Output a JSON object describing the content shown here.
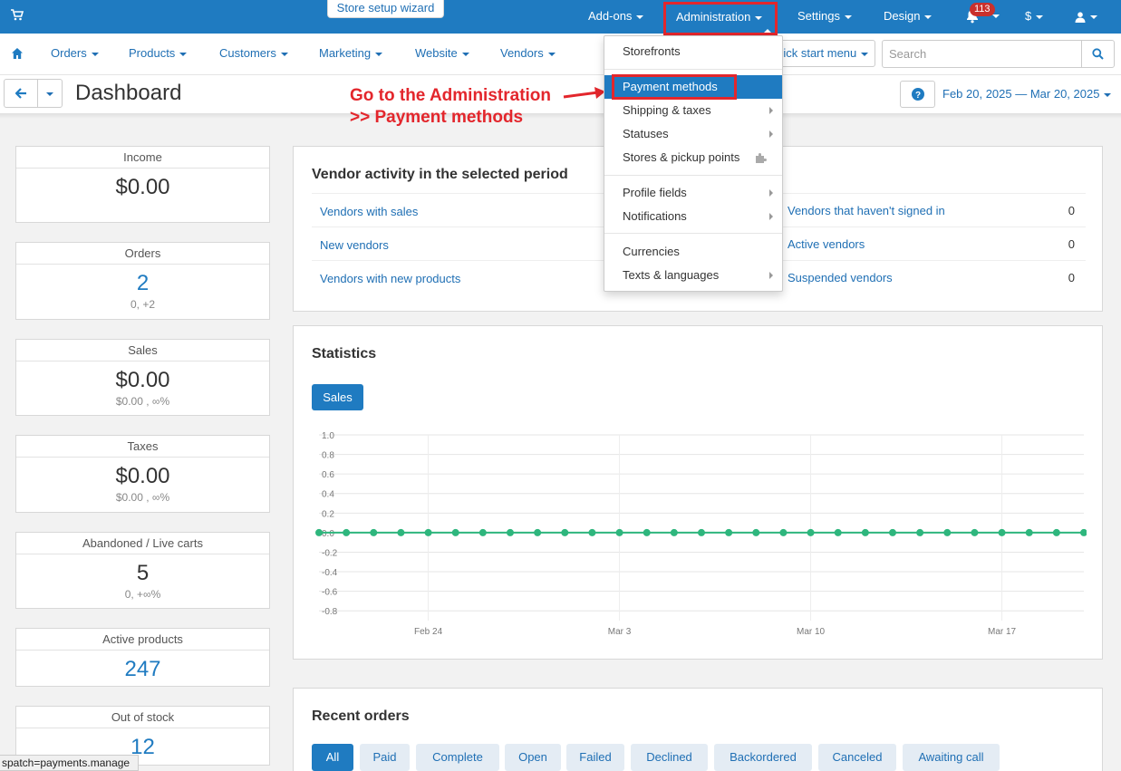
{
  "topbar": {
    "wizard_label": "Store setup wizard",
    "addons": "Add-ons",
    "administration": "Administration",
    "settings": "Settings",
    "design": "Design",
    "notification_count": "113",
    "currency": "$"
  },
  "nav": {
    "orders": "Orders",
    "products": "Products",
    "customers": "Customers",
    "marketing": "Marketing",
    "website": "Website",
    "vendors": "Vendors",
    "quick_start": "Quick start menu",
    "search_placeholder": "Search"
  },
  "header": {
    "title": "Dashboard",
    "date_range": "Feb 20, 2025 — Mar 20, 2025"
  },
  "annotation": {
    "line1": "Go to the Administration",
    "line2": ">> Payment methods"
  },
  "cards": [
    {
      "label": "Income",
      "value": "$0.00",
      "sub": ""
    },
    {
      "label": "Orders",
      "value": "2",
      "sub": "0, +2"
    },
    {
      "label": "Sales",
      "value": "$0.00",
      "sub": "$0.00 , ∞%"
    },
    {
      "label": "Taxes",
      "value": "$0.00",
      "sub": "$0.00 , ∞%"
    },
    {
      "label": "Abandoned / Live carts",
      "value": "5",
      "sub": "0, +∞%"
    },
    {
      "label": "Active products",
      "value": "247",
      "sub": ""
    },
    {
      "label": "Out of stock",
      "value": "12",
      "sub": ""
    }
  ],
  "vendor_activity": {
    "title": "Vendor activity in the selected period",
    "left": [
      "Vendors with sales",
      "New vendors",
      "Vendors with new products"
    ],
    "right": [
      {
        "label": "Vendors that haven't signed in",
        "value": "0"
      },
      {
        "label": "Active vendors",
        "value": "0"
      },
      {
        "label": "Suspended vendors",
        "value": "0"
      }
    ]
  },
  "statistics": {
    "title": "Statistics",
    "button": "Sales"
  },
  "chart_data": {
    "type": "line",
    "x": [
      "Feb 20",
      "Feb 21",
      "Feb 22",
      "Feb 23",
      "Feb 24",
      "Feb 25",
      "Feb 26",
      "Feb 27",
      "Feb 28",
      "Mar 1",
      "Mar 2",
      "Mar 3",
      "Mar 4",
      "Mar 5",
      "Mar 6",
      "Mar 7",
      "Mar 8",
      "Mar 9",
      "Mar 10",
      "Mar 11",
      "Mar 12",
      "Mar 13",
      "Mar 14",
      "Mar 15",
      "Mar 16",
      "Mar 17",
      "Mar 18",
      "Mar 19",
      "Mar 20"
    ],
    "series": [
      {
        "values": [
          0,
          0,
          0,
          0,
          0,
          0,
          0,
          0,
          0,
          0,
          0,
          0,
          0,
          0,
          0,
          0,
          0,
          0,
          0,
          0,
          0,
          0,
          0,
          0,
          0,
          0,
          0,
          0,
          0
        ]
      }
    ],
    "x_ticks": [
      "Feb 24",
      "Mar 3",
      "Mar 10",
      "Mar 17"
    ],
    "y_ticks": [
      "1.0",
      "0.8",
      "0.6",
      "0.4",
      "0.2",
      "0.0",
      "-0.2",
      "-0.4",
      "-0.6",
      "-0.8"
    ],
    "ylim": [
      -0.9,
      1.0
    ],
    "grid": true,
    "color": "#2eb67d"
  },
  "recent_orders": {
    "title": "Recent orders",
    "tabs": [
      "All",
      "Paid",
      "Complete",
      "Open",
      "Failed",
      "Declined",
      "Backordered",
      "Canceled",
      "Awaiting call"
    ]
  },
  "admin_menu": {
    "items": [
      "Storefronts",
      "Payment methods",
      "Shipping & taxes",
      "Statuses",
      "Stores & pickup points",
      "Profile fields",
      "Notifications",
      "Currencies",
      "Texts & languages"
    ]
  },
  "status_url": "spatch=payments.manage"
}
